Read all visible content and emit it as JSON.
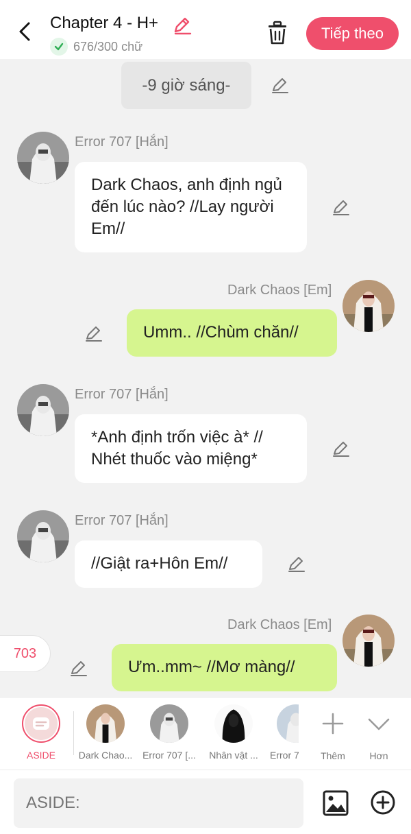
{
  "header": {
    "title": "Chapter 4 - H+",
    "word_count": "676/300 chữ",
    "next_label": "Tiếp theo"
  },
  "chat": {
    "time_marker": "-9 giờ sáng-",
    "messages": [
      {
        "side": "left",
        "name": "Error 707 [Hắn]",
        "text": "Dark Chaos, anh định ngủ đến lúc nào? //Lay người Em//"
      },
      {
        "side": "right",
        "name": "Dark Chaos [Em]",
        "text": "Umm.. //Chùm chăn//"
      },
      {
        "side": "left",
        "name": "Error 707 [Hắn]",
        "text": "*Anh định trốn việc à* // Nhét thuốc vào miệng*"
      },
      {
        "side": "left",
        "name": "Error 707 [Hắn]",
        "text": "//Giật ra+Hôn Em//"
      },
      {
        "side": "right",
        "name": "Dark Chaos [Em]",
        "text": "Ưm..mm~ //Mơ màng//"
      }
    ],
    "side_count": "703"
  },
  "character_bar": {
    "aside_label": "ASIDE",
    "characters": [
      {
        "label": "Dark Chao..."
      },
      {
        "label": "Error 707 [..."
      },
      {
        "label": "Nhân vật ..."
      },
      {
        "label": "Error 7"
      }
    ],
    "add_label": "Thêm",
    "more_label": "Hơn"
  },
  "input": {
    "placeholder": "ASIDE:"
  },
  "colors": {
    "accent": "#ef4f6c",
    "bubble_right": "#d6f58f",
    "bubble_left": "#ffffff",
    "background": "#f2f2f2"
  }
}
